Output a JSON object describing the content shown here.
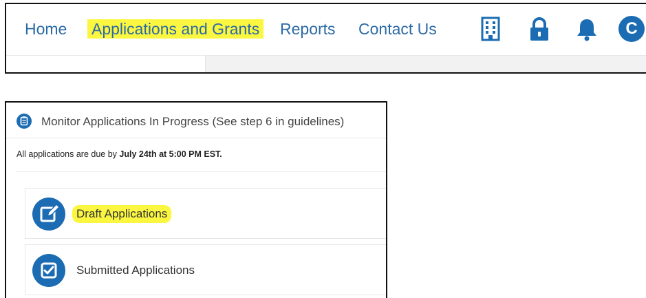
{
  "nav": {
    "links": [
      {
        "label": "Home"
      },
      {
        "label": "Applications and Grants"
      },
      {
        "label": "Reports"
      },
      {
        "label": "Contact Us"
      }
    ],
    "icons": [
      "building-icon",
      "lock-icon",
      "bell-icon"
    ],
    "avatar_initial": "C",
    "highlight_color": "#fbf740",
    "link_color": "#2c6aa6",
    "icon_color": "#1c6cb3"
  },
  "card": {
    "title": "Monitor Applications In Progress (See step 6 in guidelines)",
    "due_prefix": "All applications are due by ",
    "due_date": "July 24th at 5:00 PM EST.",
    "items": [
      {
        "label": "Draft Applications",
        "icon": "edit-icon"
      },
      {
        "label": "Submitted Applications",
        "icon": "checkbox-icon"
      }
    ]
  }
}
